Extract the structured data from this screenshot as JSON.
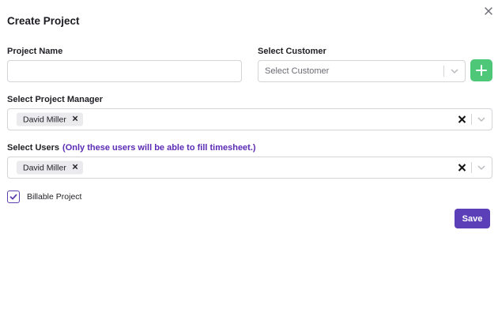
{
  "modal": {
    "title": "Create Project"
  },
  "project_name": {
    "label": "Project Name",
    "value": ""
  },
  "customer": {
    "label": "Select Customer",
    "placeholder": "Select Customer"
  },
  "project_manager": {
    "label": "Select Project Manager",
    "selected": [
      "David Miller"
    ]
  },
  "users": {
    "label": "Select Users",
    "note": "(Only these users will be able to fill timesheet.)",
    "selected": [
      "David Miller"
    ]
  },
  "billable": {
    "label": "Billable Project",
    "checked": true
  },
  "save_label": "Save",
  "colors": {
    "accent": "#5a3fb8",
    "add_button": "#4fc779",
    "note_text": "#5b2bb5"
  }
}
